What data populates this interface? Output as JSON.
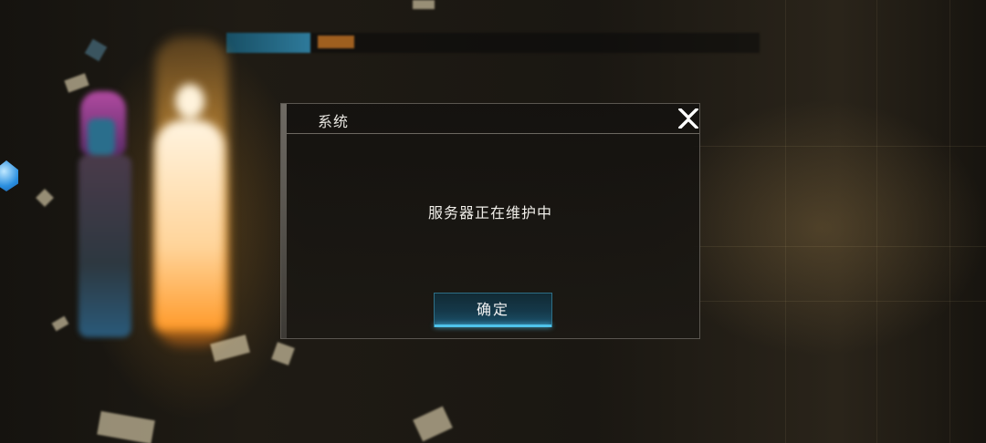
{
  "dialog": {
    "title": "系统",
    "message": "服务器正在维护中",
    "confirm_label": "确定"
  },
  "icons": {
    "close": "close-icon"
  },
  "colors": {
    "accent": "#4fc3ea",
    "dialog_background": "#1a1713",
    "text": "#f0eee9"
  }
}
